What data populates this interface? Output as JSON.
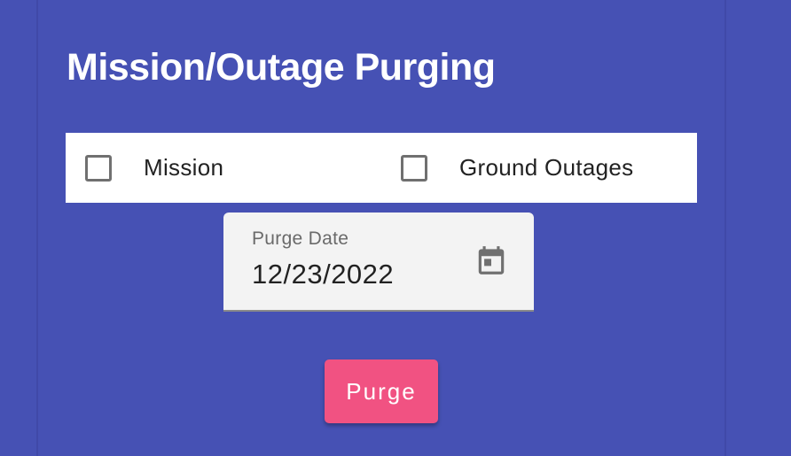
{
  "title": "Mission/Outage Purging",
  "checkboxes": [
    {
      "label": "Mission",
      "checked": false
    },
    {
      "label": "Ground Outages",
      "checked": false
    }
  ],
  "date_field": {
    "label": "Purge Date",
    "value": "12/23/2022"
  },
  "purge_button": {
    "label": "Purge"
  },
  "colors": {
    "background": "#4651b4",
    "accent_button": "#f15282",
    "checkbox_border": "#707070",
    "field_background": "#f3f3f3"
  },
  "icons": {
    "calendar": "calendar-icon"
  }
}
